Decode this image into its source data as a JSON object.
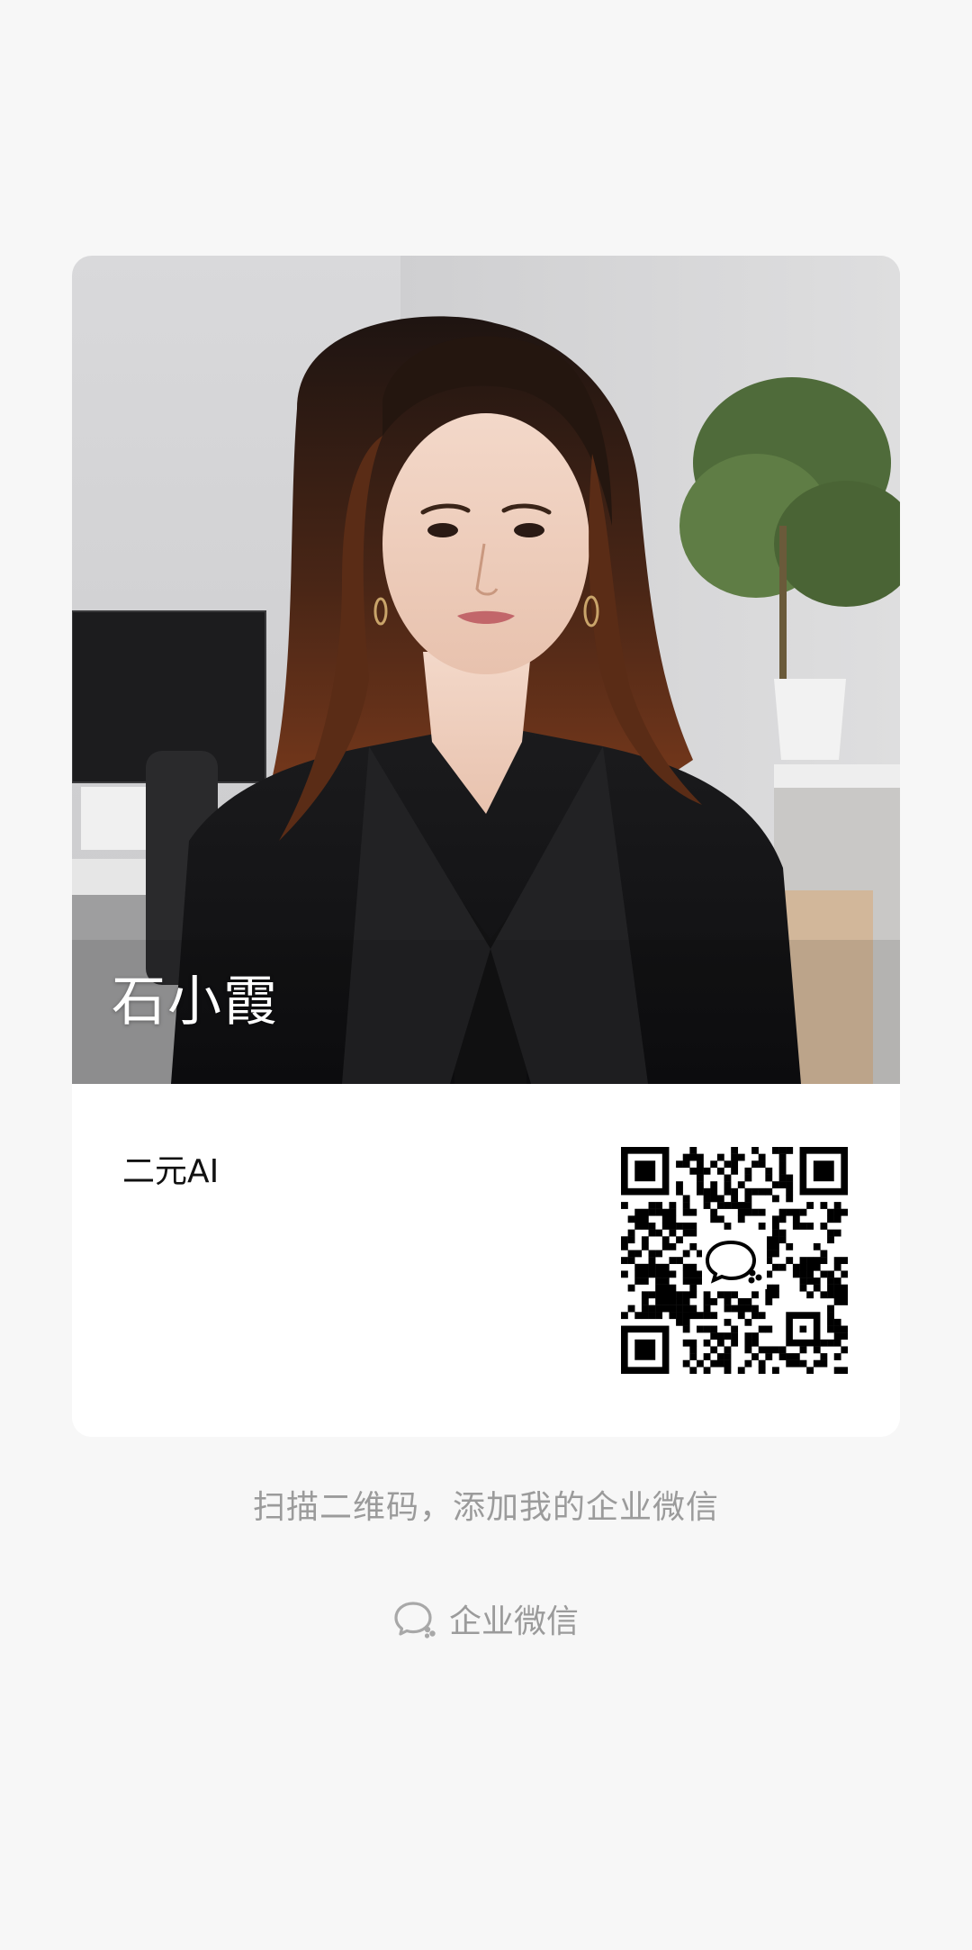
{
  "card": {
    "name": "石小霞",
    "company": "二元AI",
    "photo_icon": "profile-photo",
    "qr_icon": "qr-code"
  },
  "footer": {
    "hint": "扫描二维码，添加我的企业微信",
    "brand_label": "企业微信",
    "brand_icon": "wecom-logo-icon"
  },
  "colors": {
    "background": "#f7f7f7",
    "card": "#ffffff",
    "muted_text": "#9b9b9b"
  }
}
